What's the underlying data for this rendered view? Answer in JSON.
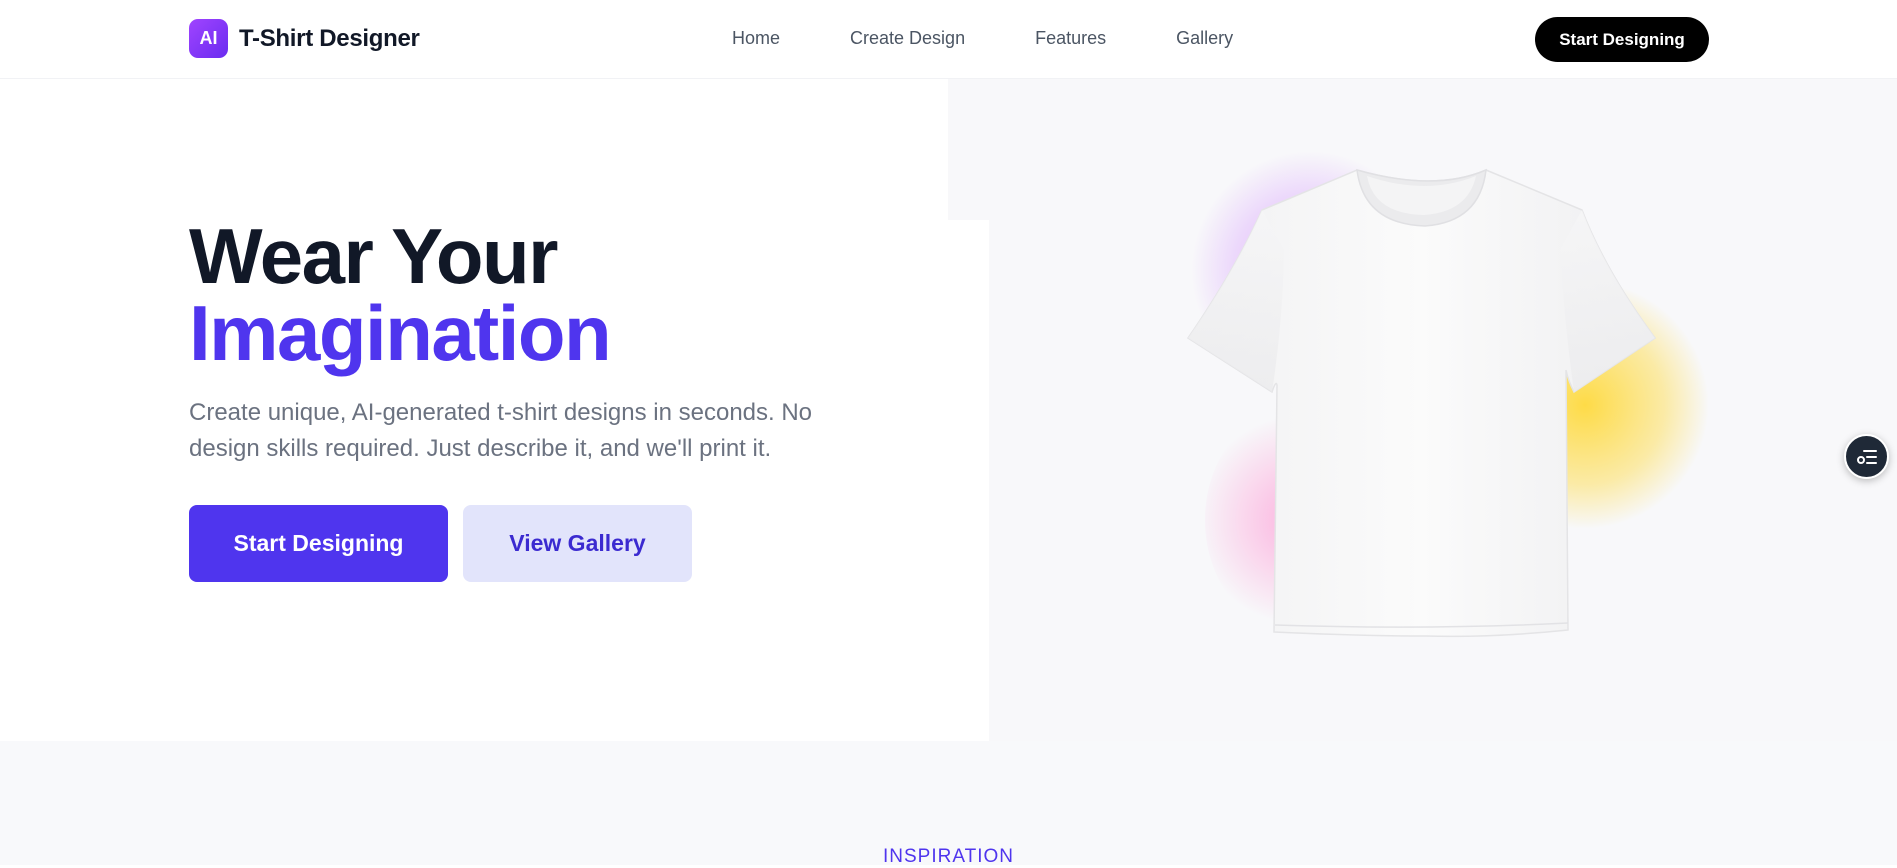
{
  "brand": {
    "badge": "AI",
    "name": "T-Shirt Designer"
  },
  "nav": {
    "items": [
      {
        "label": "Home"
      },
      {
        "label": "Create Design"
      },
      {
        "label": "Features"
      },
      {
        "label": "Gallery"
      }
    ],
    "cta_label": "Start Designing"
  },
  "hero": {
    "title_line1": "Wear Your",
    "title_line2": "Imagination",
    "subtitle": "Create unique, AI-generated t-shirt designs in seconds. No design skills required. Just describe it, and we'll print it.",
    "primary_button": "Start Designing",
    "secondary_button": "View Gallery",
    "image": "white-tshirt"
  },
  "floating_button": {
    "icon": "list-settings-icon"
  },
  "section_inspiration": {
    "eyebrow": "INSPIRATION"
  },
  "colors": {
    "accent": "#4f35ee",
    "accent_light": "#e2e4fb",
    "heading": "#111827",
    "body_text": "#6b7280",
    "header_cta_bg": "#000000"
  }
}
